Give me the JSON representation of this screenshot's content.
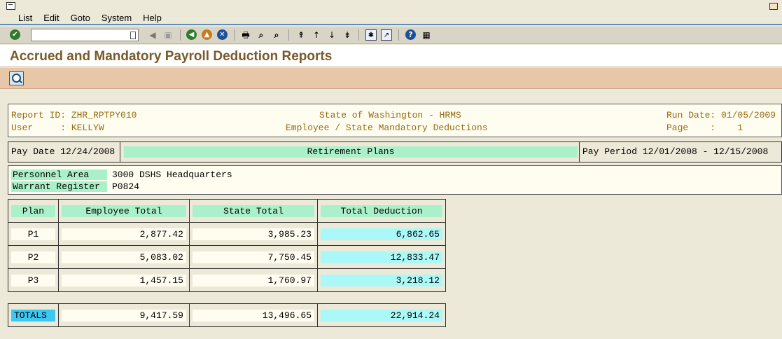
{
  "menu": {
    "items": [
      "List",
      "Edit",
      "Goto",
      "System",
      "Help"
    ]
  },
  "toolbar": {
    "command_value": ""
  },
  "app": {
    "title": "Accrued and Mandatory Payroll Deduction Reports"
  },
  "report": {
    "report_id_line": "Report ID: ZHR_RPTPY010",
    "user_line": "User     : KELLYW",
    "org_line": "State of Washington - HRMS",
    "subtitle_line": "Employee / State Mandatory Deductions",
    "run_date_line": "Run Date: 01/05/2009",
    "page_line": "Page    :    1",
    "pay_date": "Pay Date 12/24/2008",
    "section_title": "Retirement Plans",
    "pay_period": "Pay Period 12/01/2008 - 12/15/2008",
    "personnel_area_label": "Personnel Area",
    "personnel_area_value": "3000 DSHS Headquarters",
    "warrant_register_label": "Warrant Register",
    "warrant_register_value": "P0824",
    "columns": [
      "Plan",
      "Employee Total",
      "State Total",
      "Total Deduction"
    ],
    "rows": [
      {
        "plan": "P1",
        "employee": "2,877.42",
        "state": "3,985.23",
        "total": "6,862.65"
      },
      {
        "plan": "P2",
        "employee": "5,083.02",
        "state": "7,750.45",
        "total": "12,833.47"
      },
      {
        "plan": "P3",
        "employee": "1,457.15",
        "state": "1,760.97",
        "total": "3,218.12"
      }
    ],
    "totals": {
      "label": "TOTALS",
      "employee": "9,417.59",
      "state": "13,496.65",
      "total": "22,914.24"
    }
  }
}
